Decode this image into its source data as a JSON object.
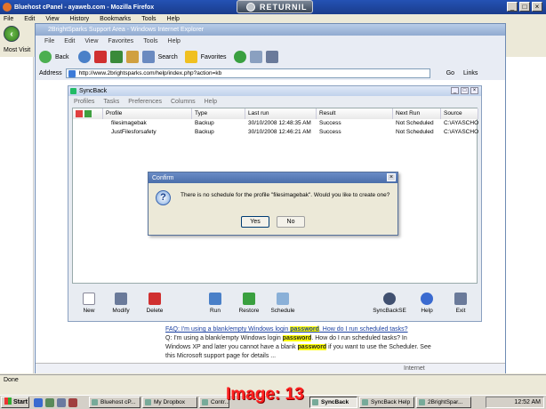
{
  "firefox": {
    "title": "Bluehost cPanel - ayaweb.com - Mozilla Firefox",
    "menu": [
      "File",
      "Edit",
      "View",
      "History",
      "Bookmarks",
      "Tools",
      "Help"
    ],
    "bookmark": "Most Visit",
    "status": "Done"
  },
  "returnil": {
    "label": "RETURNIL"
  },
  "ie": {
    "title": "2BrightSparks Support Area - Windows Internet Explorer",
    "menu": [
      "File",
      "Edit",
      "View",
      "Favorites",
      "Tools",
      "Help"
    ],
    "back": "Back",
    "search": "Search",
    "favorites": "Favorites",
    "address_label": "Address",
    "url": "http://www.2brightsparks.com/help/index.php?action=kb",
    "go": "Go",
    "links": "Links",
    "status": "Internet"
  },
  "syncback": {
    "title": "SyncBack",
    "menu": [
      "Profiles",
      "Tasks",
      "Preferences",
      "Columns",
      "Help"
    ],
    "columns": [
      "Profile",
      "Type",
      "Last run",
      "Result",
      "Next Run",
      "Source"
    ],
    "rows": [
      {
        "profile": "filesimagebak",
        "type": "Backup",
        "last_run": "30/10/2008 12:48:35 AM",
        "result": "Success",
        "next_run": "Not Scheduled",
        "source": "C:\\AYASCHOO"
      },
      {
        "profile": "JustFilesforsafety",
        "type": "Backup",
        "last_run": "30/10/2008 12:46:21 AM",
        "result": "Success",
        "next_run": "Not Scheduled",
        "source": "C:\\AYASCHOO"
      }
    ],
    "toolbar": [
      "New",
      "Modify",
      "Delete",
      "Run",
      "Restore",
      "Schedule",
      "SyncBackSE",
      "Help",
      "Exit"
    ]
  },
  "dialog": {
    "title": "Confirm",
    "message": "There is no schedule for the profile \"filesimagebak\". Would you like to create one?",
    "yes": "Yes",
    "no": "No"
  },
  "faq": {
    "q_pre": "FAQ: I'm using a blank/empty Windows login ",
    "q_hl": "password",
    "q_post": ". How do I run scheduled tasks?",
    "a1_pre": "Q: I'm using a blank/empty Windows login ",
    "a1_hl": "password",
    "a1_post": ". How do I run scheduled tasks? In",
    "a2_pre": "Windows XP and later you cannot have a blank ",
    "a2_hl": "password",
    "a2_post": " if you want to use the Scheduler. See",
    "a3": "this Microsoft support page for details ..."
  },
  "taskbar": {
    "start": "Start",
    "tasks": [
      "Bluehost cP...",
      "My Dropbox",
      "Contr...",
      "SyncBack",
      "SyncBack Help",
      "2BrightSpar..."
    ],
    "active_index": 3,
    "clock": "12:52 AM"
  },
  "overlay": {
    "text": "Image: 13"
  },
  "colors": {
    "highlight": "#ffff00",
    "overlay_text": "#ff2020",
    "link": "#1a3fa0"
  }
}
